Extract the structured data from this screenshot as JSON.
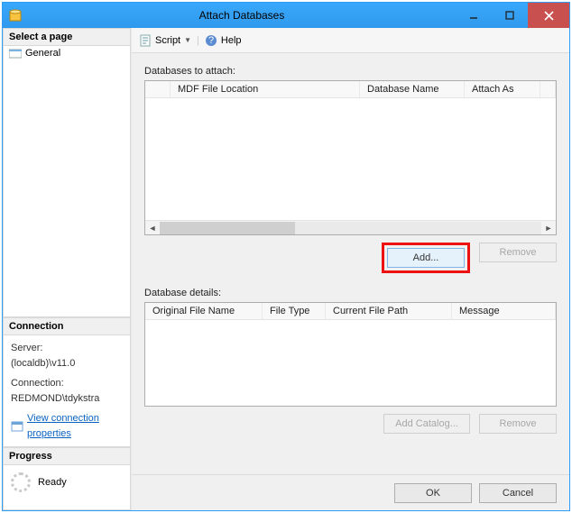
{
  "title": "Attach Databases",
  "sidebar": {
    "select_page_header": "Select a page",
    "general_label": "General",
    "connection": {
      "header": "Connection",
      "server_label": "Server:",
      "server_value": "(localdb)\\v11.0",
      "connection_label": "Connection:",
      "connection_value": "REDMOND\\tdykstra",
      "view_props_link": "View connection properties"
    },
    "progress": {
      "header": "Progress",
      "status": "Ready"
    }
  },
  "toolbar": {
    "script_label": "Script",
    "help_label": "Help"
  },
  "main": {
    "attach_label": "Databases to attach:",
    "attach_columns": {
      "c1": "MDF File Location",
      "c2": "Database Name",
      "c3": "Attach As"
    },
    "add_btn": "Add...",
    "remove_btn": "Remove",
    "details_label": "Database details:",
    "details_columns": {
      "c1": "Original File Name",
      "c2": "File Type",
      "c3": "Current File Path",
      "c4": "Message"
    },
    "add_catalog_btn": "Add Catalog...",
    "remove2_btn": "Remove"
  },
  "footer": {
    "ok": "OK",
    "cancel": "Cancel"
  }
}
